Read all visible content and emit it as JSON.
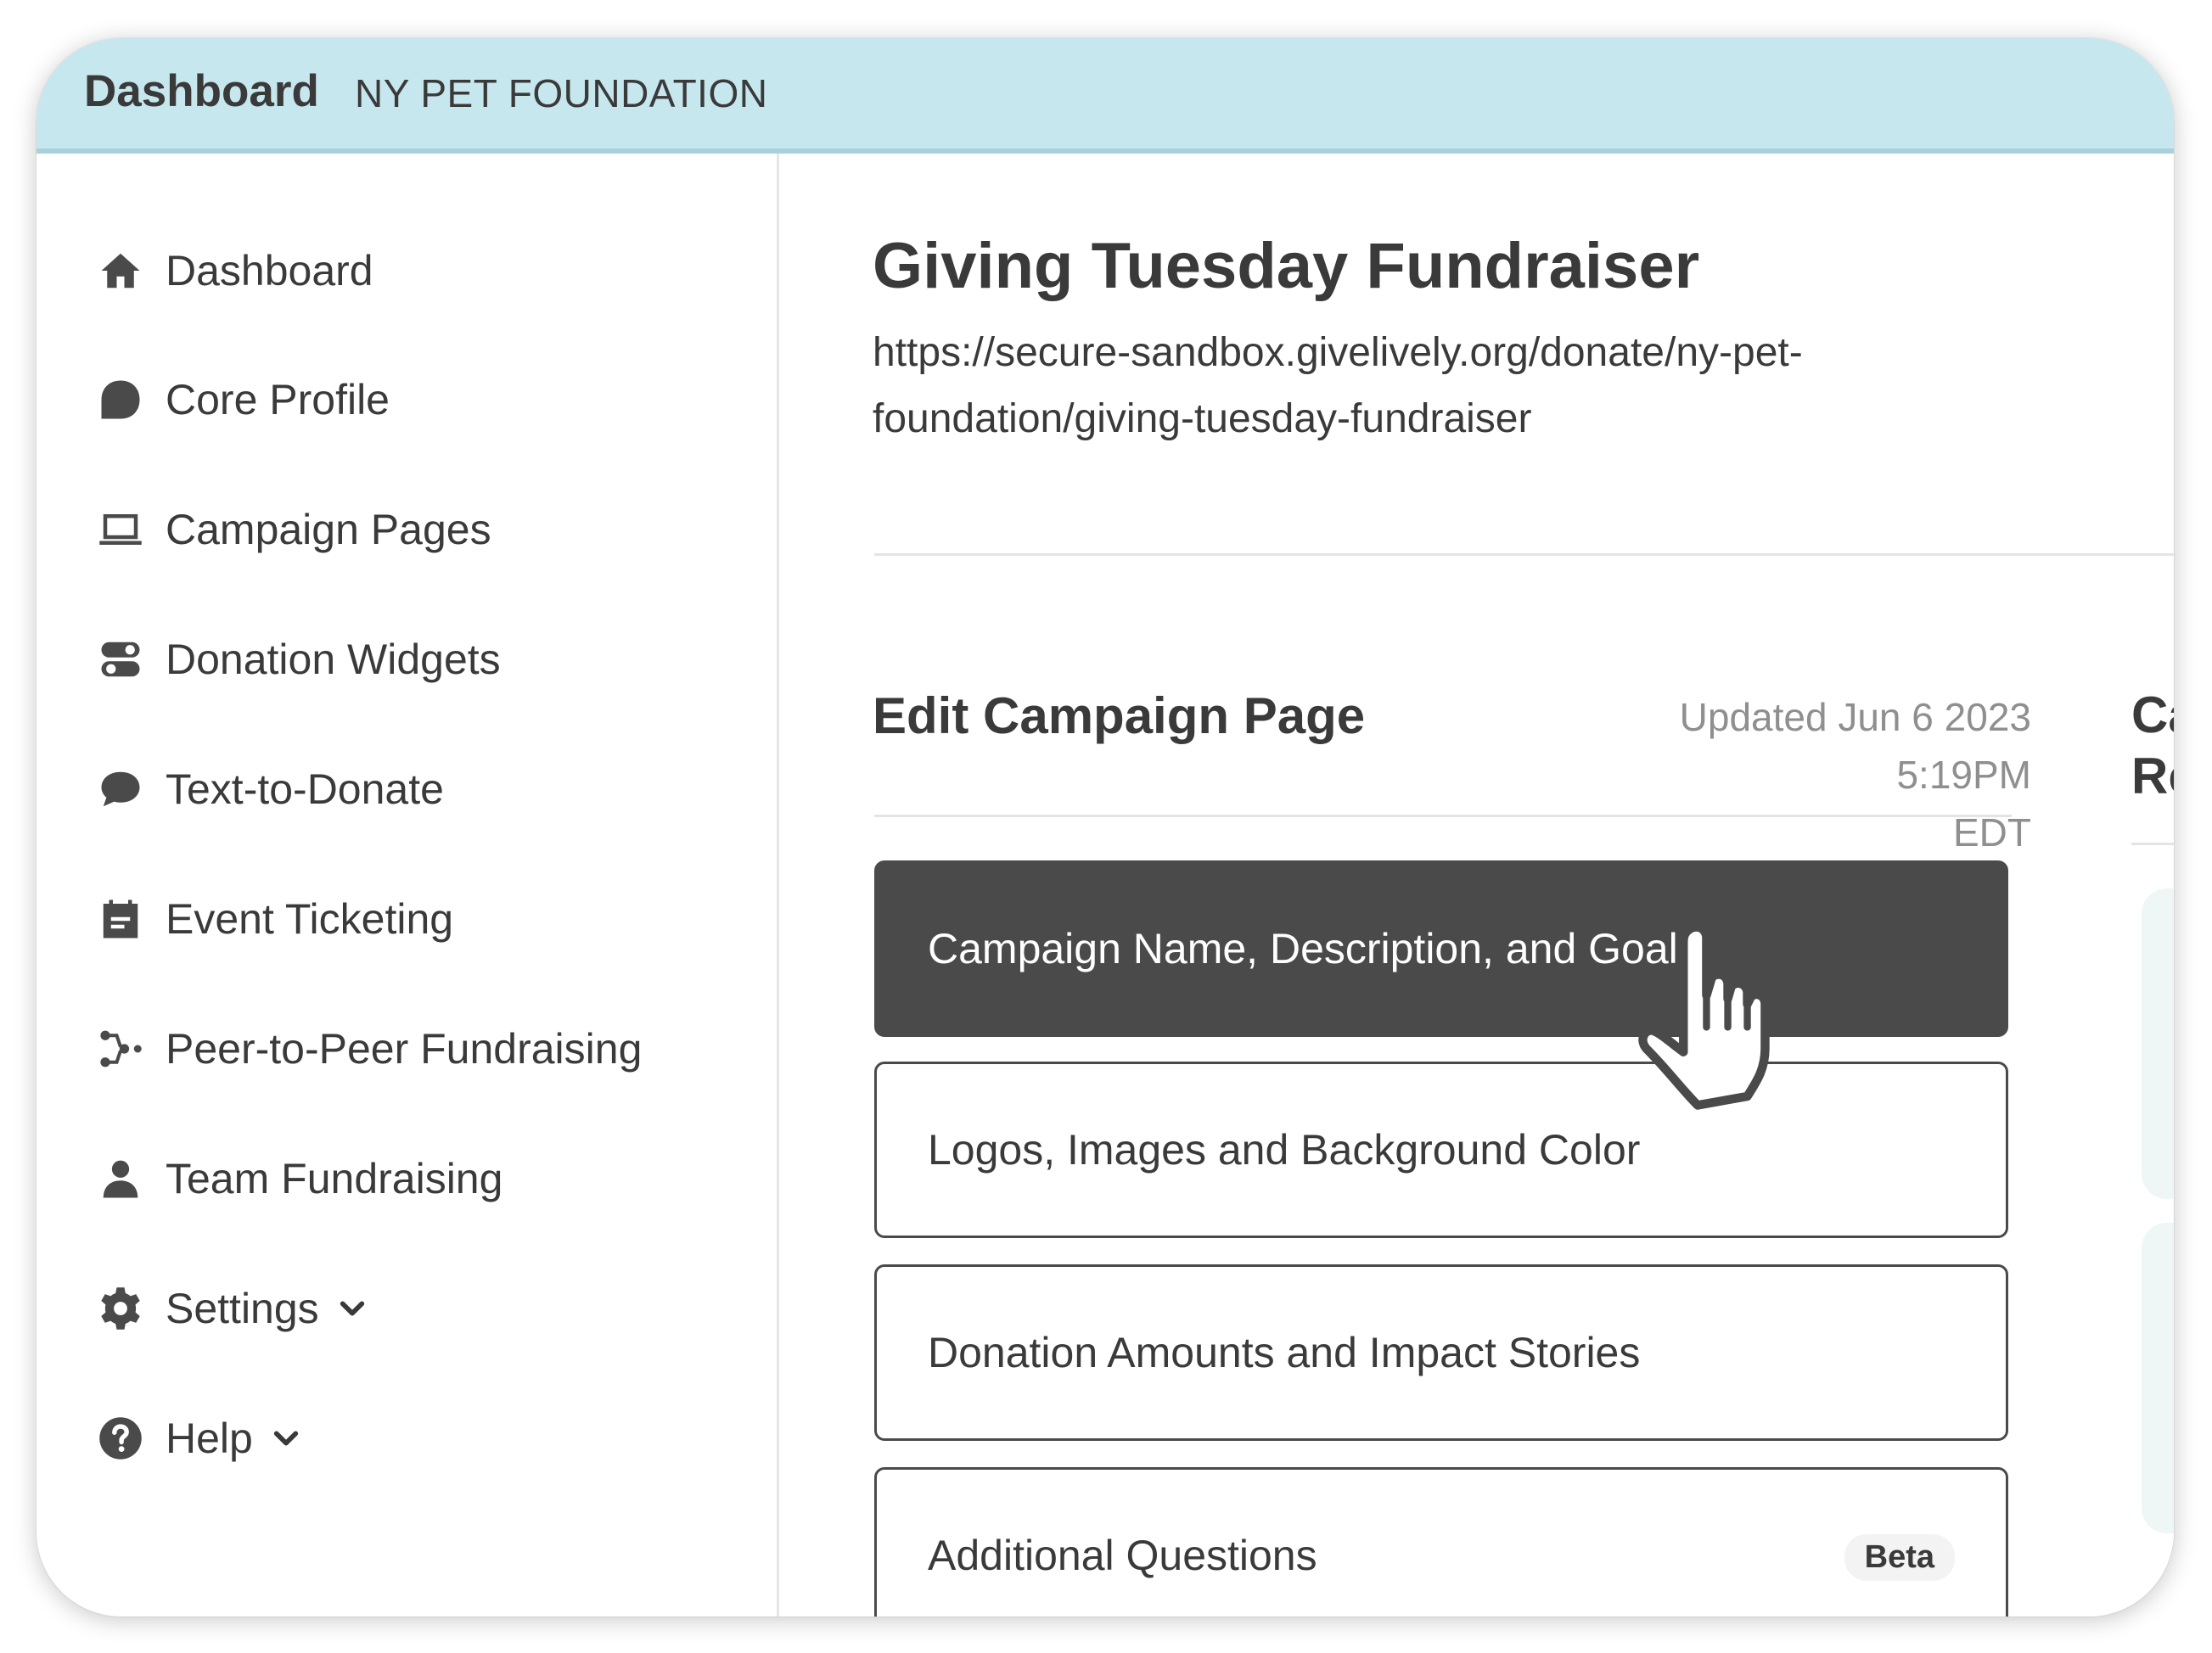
{
  "header": {
    "brand": "Dashboard",
    "organization": "NY PET FOUNDATION"
  },
  "sidebar": {
    "items": [
      {
        "label": "Dashboard",
        "icon": "home-icon"
      },
      {
        "label": "Core Profile",
        "icon": "profile-blob-icon"
      },
      {
        "label": "Campaign Pages",
        "icon": "laptop-icon"
      },
      {
        "label": "Donation Widgets",
        "icon": "toggles-icon"
      },
      {
        "label": "Text-to-Donate",
        "icon": "chat-bubble-icon"
      },
      {
        "label": "Event Ticketing",
        "icon": "calendar-icon"
      },
      {
        "label": "Peer-to-Peer Fundraising",
        "icon": "network-icon"
      },
      {
        "label": "Team Fundraising",
        "icon": "person-icon"
      },
      {
        "label": "Settings",
        "icon": "gear-icon",
        "expandable": true
      },
      {
        "label": "Help",
        "icon": "question-icon",
        "expandable": true
      }
    ]
  },
  "main": {
    "title": "Giving Tuesday Fundraiser",
    "url_line1": "https://secure-sandbox.givelively.org/donate/ny-pet-",
    "url_line2": "foundation/giving-tuesday-fundraiser",
    "section_title": "Edit Campaign Page",
    "updated_line1": "Updated Jun 6 2023 5:19PM",
    "updated_line2": "EDT",
    "menu": [
      {
        "label": "Campaign Name, Description, and Goal",
        "active": true
      },
      {
        "label": "Logos, Images and Background Color",
        "active": false
      },
      {
        "label": "Donation Amounts and Impact Stories",
        "active": false
      },
      {
        "label": "Additional Questions",
        "active": false,
        "badge": "Beta"
      }
    ],
    "right_column_title_line1": "Car",
    "right_column_title_line2": "Res"
  },
  "colors": {
    "header_bg": "#c6e7ee",
    "active_row_bg": "#4a4a4a",
    "text": "#3a3a3a",
    "muted": "#8f8f8f"
  }
}
